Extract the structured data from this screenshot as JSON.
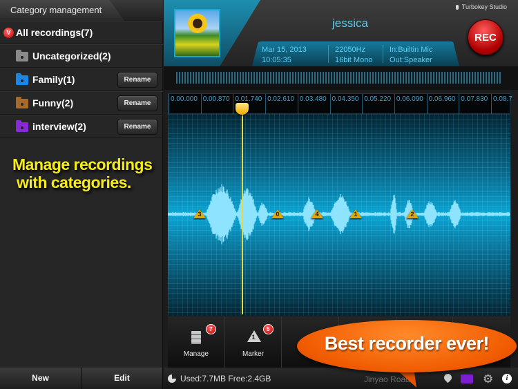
{
  "left_panel": {
    "title": "Category management",
    "all_recordings": {
      "label": "All recordings(7)",
      "badge": "V"
    },
    "categories": [
      {
        "label": "Uncategorized(2)",
        "folder_color": "#8a8a8a",
        "rename": null
      },
      {
        "label": "Family(1)",
        "folder_color": "#1c86e6",
        "rename": "Rename"
      },
      {
        "label": "Funny(2)",
        "folder_color": "#a86a2c",
        "rename": "Rename"
      },
      {
        "label": "interview(2)",
        "folder_color": "#8a2ad6",
        "rename": "Rename"
      }
    ],
    "promo_line1": "Manage recordings",
    "promo_line2": "with categories.",
    "bottom": {
      "new_label": "New",
      "edit_label": "Edit"
    }
  },
  "header": {
    "studio": "Turbokey Studio",
    "track_name": "jessica",
    "date": "Mar 15, 2013",
    "time": "10:05:35",
    "sample_rate": "22050Hz",
    "format": "16bit Mono",
    "input": "In:Builtin Mic",
    "output": "Out:Speaker",
    "rec_label": "REC"
  },
  "timeline": {
    "ticks": [
      "0.00.000",
      "0.00.870",
      "0.01.740",
      "0.02.610",
      "0.03.480",
      "0.04.350",
      "0.05.220",
      "0.06.090",
      "0.06.960",
      "0.07.830",
      "0.08.7"
    ],
    "playhead_time": "0.01.740"
  },
  "markers": [
    {
      "label": "3"
    },
    {
      "label": "0"
    },
    {
      "label": "4"
    },
    {
      "label": "1"
    },
    {
      "label": "2"
    }
  ],
  "toolbar": {
    "items": [
      {
        "label": "Manage",
        "badge": "7",
        "icon": "drawer-icon"
      },
      {
        "label": "Marker",
        "badge": "5",
        "icon": "warning-icon"
      },
      {
        "label": "",
        "badge": null,
        "icon": ""
      },
      {
        "label": "",
        "badge": null,
        "icon": ""
      },
      {
        "label": "",
        "badge": null,
        "icon": ""
      },
      {
        "label": "",
        "badge": null,
        "icon": ""
      }
    ]
  },
  "status_bar": {
    "storage": "Used:7.7MB Free:2.4GB",
    "location": "Jinyao Road"
  },
  "promo_bubble": "Best recorder ever!",
  "colors": {
    "accent": "#5dc9ec",
    "rec_red": "#c20000",
    "promo_yellow": "#f5ec1a",
    "bubble_orange": "#f05a00"
  }
}
